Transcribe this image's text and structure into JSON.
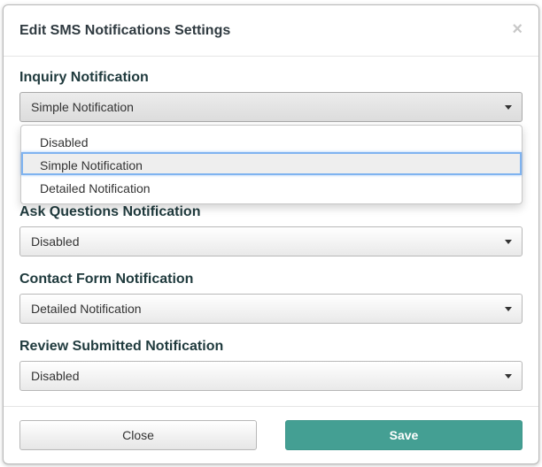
{
  "dialog": {
    "title": "Edit SMS Notifications Settings",
    "close_glyph": "×"
  },
  "fields": [
    {
      "label": "Inquiry Notification",
      "value": "Simple Notification",
      "open": true
    },
    {
      "label": "Ask Questions Notification",
      "value": "Disabled"
    },
    {
      "label": "Contact Form Notification",
      "value": "Detailed Notification"
    },
    {
      "label": "Review Submitted Notification",
      "value": "Disabled"
    }
  ],
  "dropdown": {
    "options": [
      "Disabled",
      "Simple Notification",
      "Detailed Notification"
    ],
    "highlighted_index": 1
  },
  "footer": {
    "close_label": "Close",
    "save_label": "Save"
  },
  "colors": {
    "save_button": "#449f93",
    "focus_ring": "#7fb3f0",
    "label_text": "#1f3a3d"
  },
  "icons": {
    "dialog_close": "close-icon",
    "select_arrow": "caret-down-icon"
  }
}
